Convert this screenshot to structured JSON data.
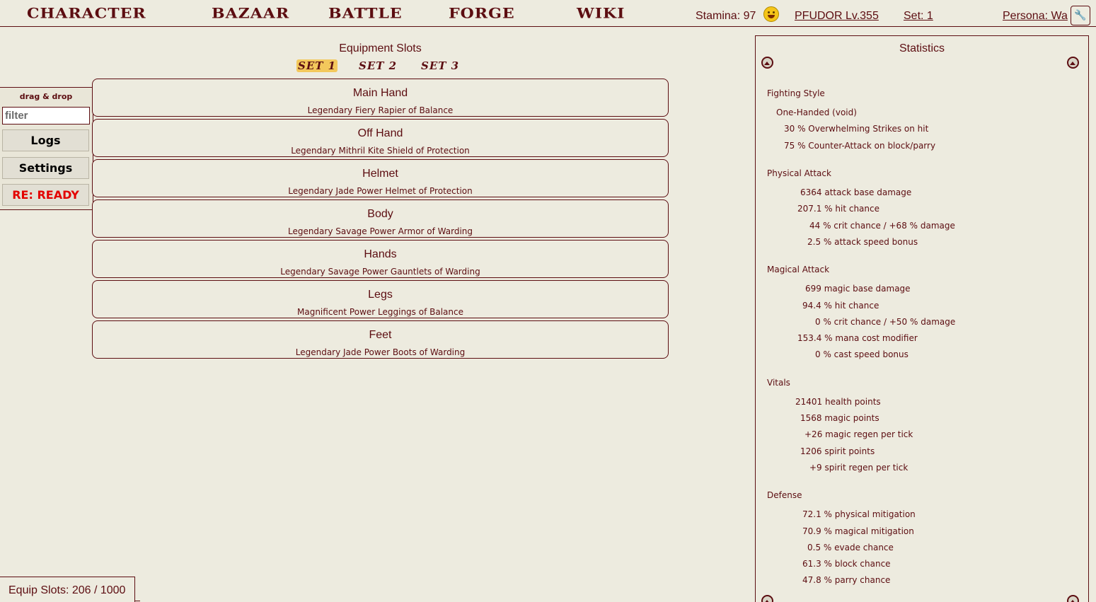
{
  "nav": {
    "character": "CHARACTER",
    "bazaar": "BAZAAR",
    "battle": "BATTLE",
    "forge": "FORGE",
    "wiki": "WIKI"
  },
  "top": {
    "stamina": "Stamina: 97",
    "player": "PFUDOR Lv.355",
    "set": "Set: 1",
    "persona": "Persona: Wa"
  },
  "left": {
    "drag_drop": "drag & drop",
    "filter_placeholder": "filter",
    "logs": "Logs",
    "settings": "Settings",
    "ready": "RE: READY"
  },
  "equipment": {
    "title": "Equipment Slots",
    "sets": [
      "SET 1",
      "SET 2",
      "SET 3"
    ],
    "slots": [
      {
        "name": "Main Hand",
        "item": "Legendary Fiery Rapier of Balance"
      },
      {
        "name": "Off Hand",
        "item": "Legendary Mithril Kite Shield of Protection"
      },
      {
        "name": "Helmet",
        "item": "Legendary Jade Power Helmet of Protection"
      },
      {
        "name": "Body",
        "item": "Legendary Savage Power Armor of Warding"
      },
      {
        "name": "Hands",
        "item": "Legendary Savage Power Gauntlets of Warding"
      },
      {
        "name": "Legs",
        "item": "Magnificent Power Leggings of Balance"
      },
      {
        "name": "Feet",
        "item": "Legendary Jade Power Boots of Warding"
      }
    ],
    "count": "Equip Slots: 206 / 1000"
  },
  "stats": {
    "title": "Statistics",
    "fighting_style": {
      "head": "Fighting Style",
      "lines": [
        "One-Handed (void)",
        "30 % Overwhelming Strikes on hit",
        "75 % Counter-Attack on block/parry"
      ]
    },
    "physical": {
      "head": "Physical Attack",
      "lines": [
        "6364 attack base damage",
        "207.1 % hit chance",
        "44 % crit chance / +68 % damage",
        "2.5 % attack speed bonus"
      ]
    },
    "magical": {
      "head": "Magical Attack",
      "lines": [
        "699 magic base damage",
        "94.4 % hit chance",
        "0 % crit chance / +50 % damage",
        "153.4 % mana cost modifier",
        "0 % cast speed bonus"
      ]
    },
    "vitals": {
      "head": "Vitals",
      "lines": [
        "21401 health points",
        "1568 magic points",
        "+26 magic regen per tick",
        "1206 spirit points",
        "+9 spirit regen per tick"
      ]
    },
    "defense": {
      "head": "Defense",
      "lines": [
        "72.1 % physical mitigation",
        "70.9 % magical mitigation",
        "0.5 % evade chance",
        "61.3 % block chance",
        "47.8 % parry chance"
      ]
    }
  }
}
